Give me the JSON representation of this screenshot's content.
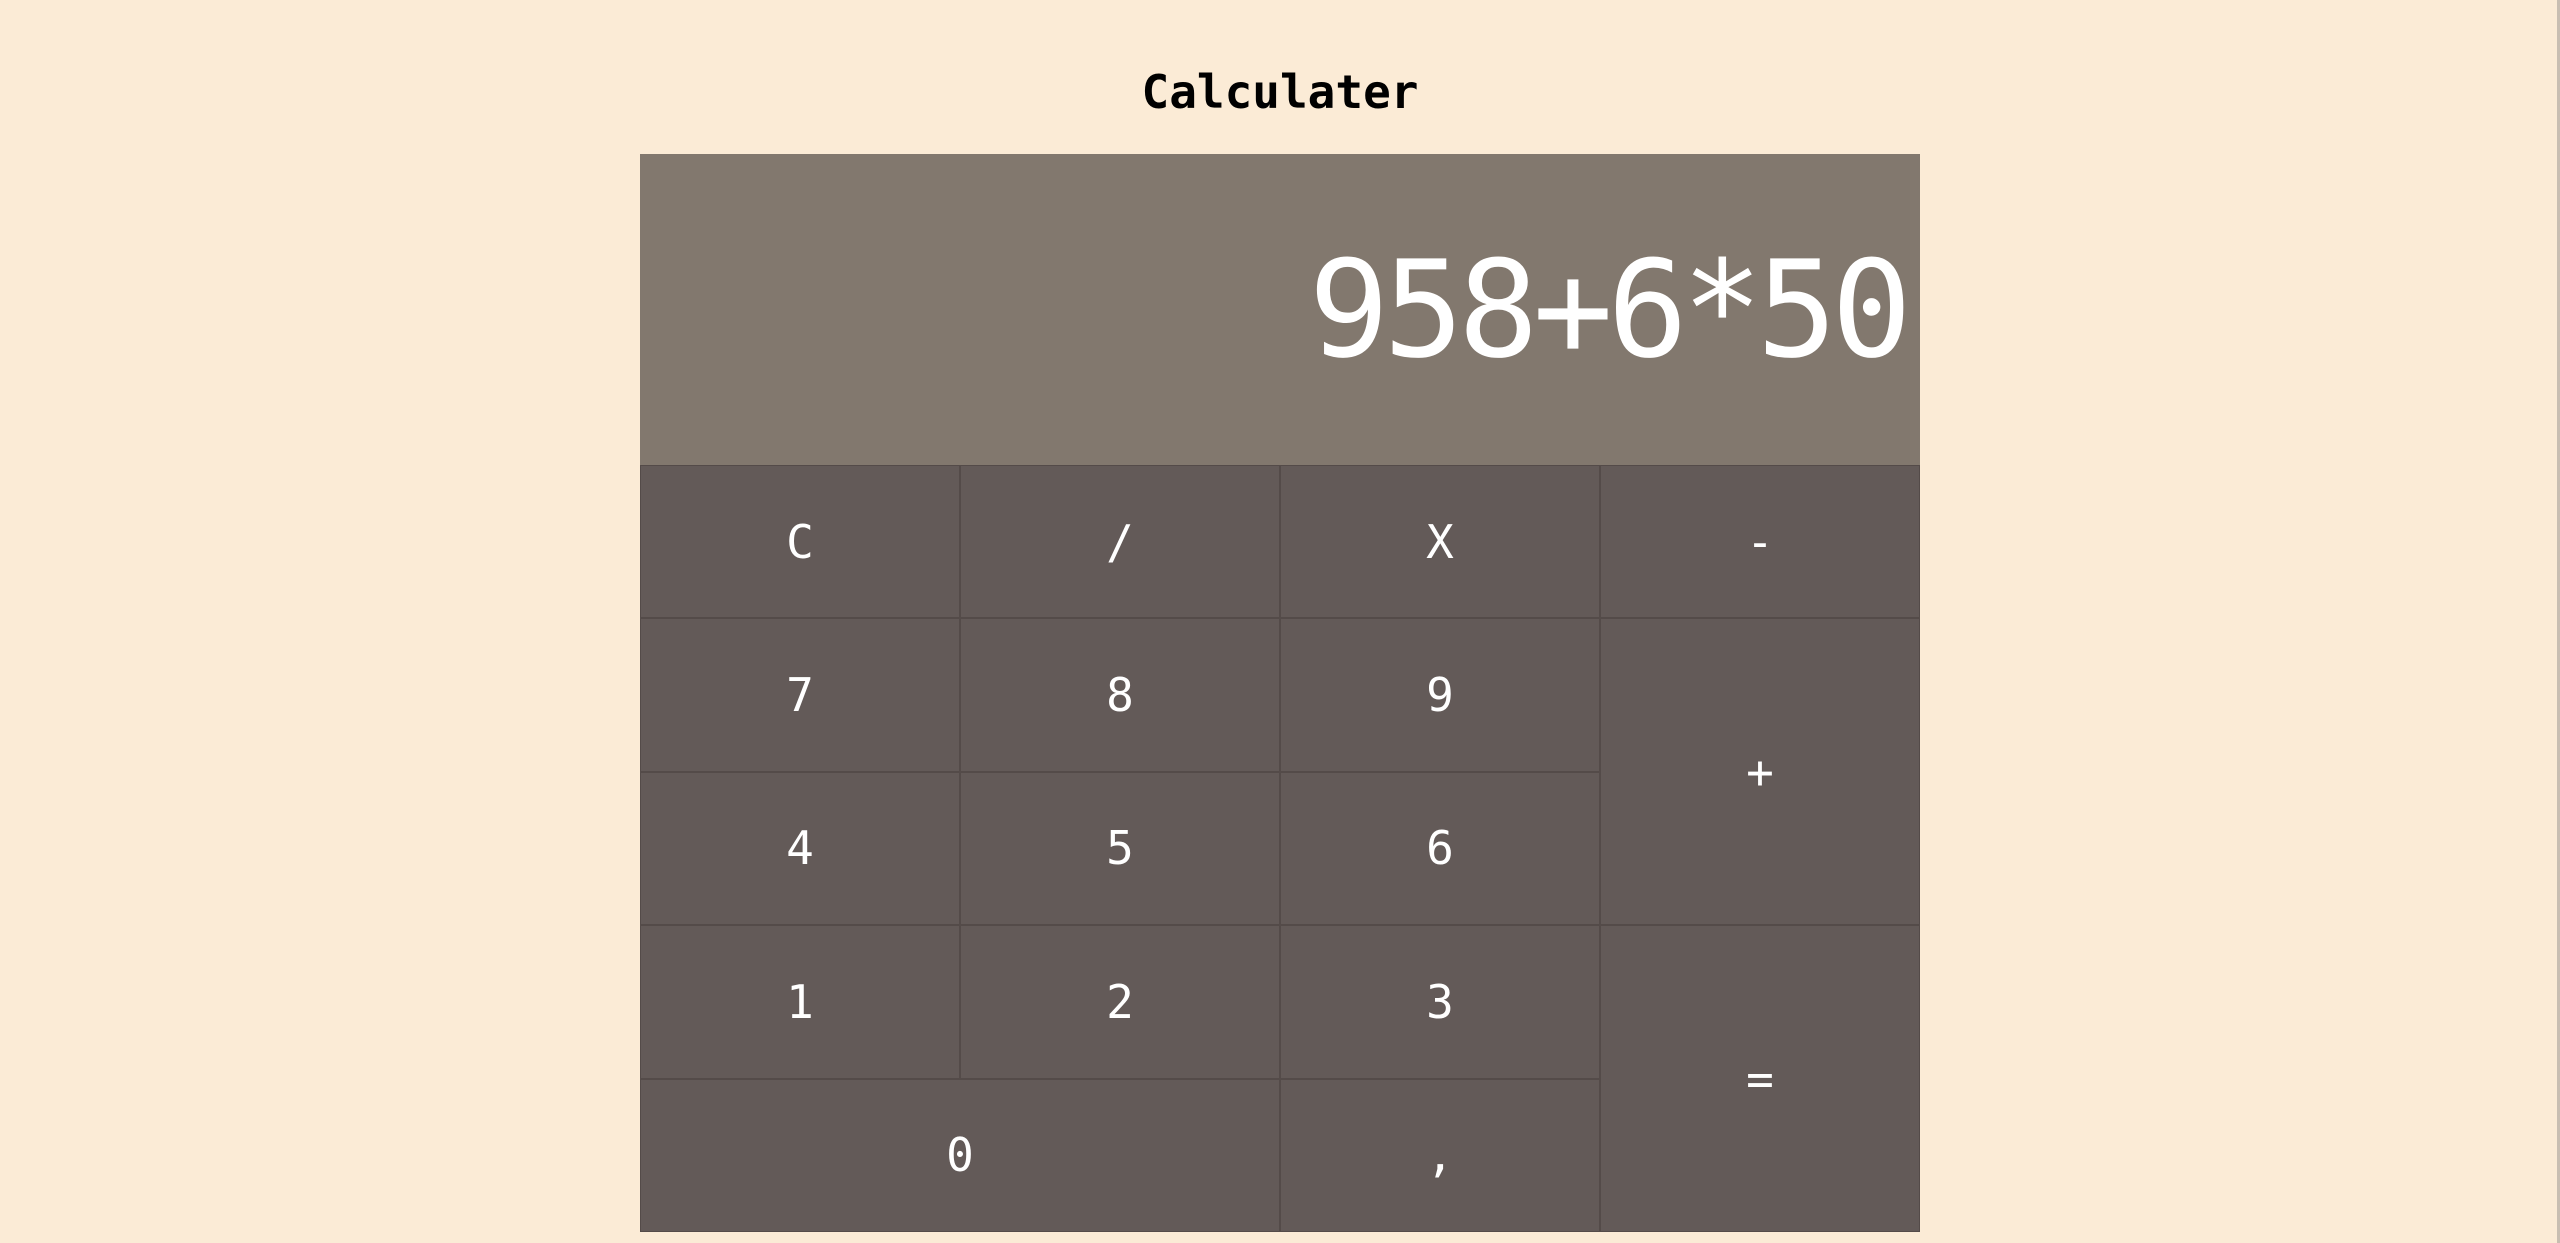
{
  "title": "Calculater",
  "display": {
    "value": "958+6*50"
  },
  "keys": {
    "clear": "C",
    "divide": "/",
    "multiply": "X",
    "minus": "-",
    "seven": "7",
    "eight": "8",
    "nine": "9",
    "plus": "+",
    "four": "4",
    "five": "5",
    "six": "6",
    "one": "1",
    "two": "2",
    "three": "3",
    "equals": "=",
    "zero": "0",
    "comma": ","
  },
  "colors": {
    "page_background": "#fbebd6",
    "display_background": "#82786e",
    "key_background": "#635a58",
    "text_light": "#ffffff"
  }
}
